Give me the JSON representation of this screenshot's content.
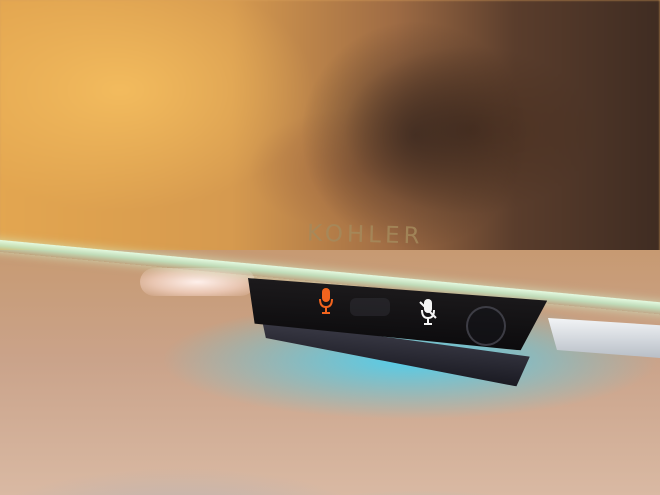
{
  "photo": {
    "brand_logo": "KOHLER",
    "colors": {
      "warm_background": "#d69a4f",
      "cyan_glow": "#46d2f5",
      "glass_edge": "#c6ebd0",
      "control_bar": "#141214",
      "orange_mic": "#f2641e",
      "white_mic": "#f5f5f5"
    },
    "icons": [
      "microphone-orange-icon",
      "microphone-muted-white-icon",
      "round-button"
    ]
  }
}
